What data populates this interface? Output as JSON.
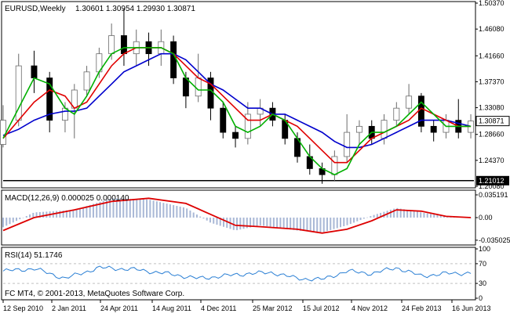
{
  "header": {
    "symbol": "EURUSD,Weekly",
    "ohlc": "1.30601 1.30954 1.29930 1.30871"
  },
  "watermark": "FC MT4, © 2001-2013, MetaQuotes Software Corp.",
  "colors": {
    "bull": "#6b6b6b",
    "bear": "#000000",
    "ma_fast": "#00b000",
    "ma_mid": "#e00000",
    "ma_slow": "#0000cc",
    "macd_hist": "#a9b8d6",
    "macd_signal": "#dd0000",
    "rsi": "#2a7fd4",
    "grid": "#c0c0c0",
    "level_line": "#000000"
  },
  "price_axis": {
    "ticks": [
      "1.50370",
      "1.46080",
      "1.41660",
      "1.37370",
      "1.33080",
      "1.28660",
      "1.24370",
      "1.20080"
    ],
    "current_price": "1.30871",
    "level_price": "1.21012"
  },
  "x_axis": {
    "labels": [
      "12 Sep 2010",
      "2 Jan 2011",
      "24 Apr 2011",
      "14 Aug 2011",
      "4 Dec 2011",
      "25 Mar 2012",
      "15 Jul 2012",
      "4 Nov 2012",
      "24 Feb 2013",
      "16 Jun 2013"
    ]
  },
  "macd": {
    "label": "MACD(12,26,9) 0.000025 0.000140",
    "ticks": [
      "0.035191",
      "0.00",
      "-0.035025"
    ]
  },
  "rsi": {
    "label": "RSI(14) 51.1746",
    "ticks": [
      "100",
      "70",
      "30",
      "0"
    ]
  },
  "chart_data": [
    {
      "type": "candlestick",
      "title": "EURUSD,Weekly",
      "ylim": [
        1.2008,
        1.5037
      ],
      "level_line": 1.21012,
      "x_range": [
        "2010-08-01",
        "2013-06-30"
      ],
      "candles": [
        {
          "d": "2010-08-01",
          "o": 1.27,
          "h": 1.335,
          "l": 1.265,
          "c": 1.31
        },
        {
          "d": "2010-09-05",
          "o": 1.31,
          "h": 1.42,
          "l": 1.3,
          "c": 1.4
        },
        {
          "d": "2010-10-10",
          "o": 1.4,
          "h": 1.425,
          "l": 1.355,
          "c": 1.38
        },
        {
          "d": "2010-11-14",
          "o": 1.38,
          "h": 1.39,
          "l": 1.29,
          "c": 1.31
        },
        {
          "d": "2010-12-19",
          "o": 1.31,
          "h": 1.34,
          "l": 1.29,
          "c": 1.33
        },
        {
          "d": "2011-01-09",
          "o": 1.33,
          "h": 1.37,
          "l": 1.28,
          "c": 1.36
        },
        {
          "d": "2011-02-06",
          "o": 1.36,
          "h": 1.4,
          "l": 1.35,
          "c": 1.39
        },
        {
          "d": "2011-03-06",
          "o": 1.39,
          "h": 1.43,
          "l": 1.38,
          "c": 1.42
        },
        {
          "d": "2011-04-03",
          "o": 1.42,
          "h": 1.47,
          "l": 1.41,
          "c": 1.45
        },
        {
          "d": "2011-05-01",
          "o": 1.45,
          "h": 1.495,
          "l": 1.4,
          "c": 1.42
        },
        {
          "d": "2011-05-29",
          "o": 1.42,
          "h": 1.46,
          "l": 1.4,
          "c": 1.44
        },
        {
          "d": "2011-06-26",
          "o": 1.44,
          "h": 1.455,
          "l": 1.4,
          "c": 1.42
        },
        {
          "d": "2011-07-24",
          "o": 1.42,
          "h": 1.46,
          "l": 1.4,
          "c": 1.44
        },
        {
          "d": "2011-08-21",
          "o": 1.44,
          "h": 1.45,
          "l": 1.37,
          "c": 1.38
        },
        {
          "d": "2011-09-18",
          "o": 1.38,
          "h": 1.39,
          "l": 1.33,
          "c": 1.35
        },
        {
          "d": "2011-10-16",
          "o": 1.35,
          "h": 1.42,
          "l": 1.34,
          "c": 1.38
        },
        {
          "d": "2011-11-13",
          "o": 1.38,
          "h": 1.39,
          "l": 1.31,
          "c": 1.33
        },
        {
          "d": "2011-12-11",
          "o": 1.33,
          "h": 1.34,
          "l": 1.28,
          "c": 1.29
        },
        {
          "d": "2012-01-08",
          "o": 1.29,
          "h": 1.3,
          "l": 1.265,
          "c": 1.28
        },
        {
          "d": "2012-02-05",
          "o": 1.28,
          "h": 1.34,
          "l": 1.27,
          "c": 1.32
        },
        {
          "d": "2012-03-04",
          "o": 1.32,
          "h": 1.345,
          "l": 1.3,
          "c": 1.33
        },
        {
          "d": "2012-04-01",
          "o": 1.33,
          "h": 1.34,
          "l": 1.3,
          "c": 1.31
        },
        {
          "d": "2012-04-29",
          "o": 1.31,
          "h": 1.32,
          "l": 1.27,
          "c": 1.28
        },
        {
          "d": "2012-05-27",
          "o": 1.28,
          "h": 1.29,
          "l": 1.24,
          "c": 1.25
        },
        {
          "d": "2012-06-24",
          "o": 1.25,
          "h": 1.27,
          "l": 1.22,
          "c": 1.23
        },
        {
          "d": "2012-07-22",
          "o": 1.23,
          "h": 1.24,
          "l": 1.205,
          "c": 1.22
        },
        {
          "d": "2012-08-19",
          "o": 1.22,
          "h": 1.26,
          "l": 1.21,
          "c": 1.25
        },
        {
          "d": "2012-09-16",
          "o": 1.25,
          "h": 1.32,
          "l": 1.24,
          "c": 1.29
        },
        {
          "d": "2012-10-14",
          "o": 1.29,
          "h": 1.31,
          "l": 1.27,
          "c": 1.3
        },
        {
          "d": "2012-11-11",
          "o": 1.3,
          "h": 1.31,
          "l": 1.27,
          "c": 1.28
        },
        {
          "d": "2012-12-09",
          "o": 1.28,
          "h": 1.32,
          "l": 1.27,
          "c": 1.31
        },
        {
          "d": "2013-01-06",
          "o": 1.31,
          "h": 1.34,
          "l": 1.3,
          "c": 1.33
        },
        {
          "d": "2013-02-03",
          "o": 1.33,
          "h": 1.37,
          "l": 1.32,
          "c": 1.35
        },
        {
          "d": "2013-03-03",
          "o": 1.35,
          "h": 1.355,
          "l": 1.29,
          "c": 1.3
        },
        {
          "d": "2013-03-31",
          "o": 1.3,
          "h": 1.31,
          "l": 1.275,
          "c": 1.29
        },
        {
          "d": "2013-04-28",
          "o": 1.29,
          "h": 1.32,
          "l": 1.28,
          "c": 1.31
        },
        {
          "d": "2013-05-26",
          "o": 1.31,
          "h": 1.345,
          "l": 1.28,
          "c": 1.29
        },
        {
          "d": "2013-06-23",
          "o": 1.29,
          "h": 1.32,
          "l": 1.28,
          "c": 1.30871
        }
      ],
      "ma_fast": [
        1.28,
        1.33,
        1.38,
        1.37,
        1.33,
        1.32,
        1.35,
        1.39,
        1.42,
        1.43,
        1.43,
        1.43,
        1.43,
        1.42,
        1.38,
        1.36,
        1.36,
        1.34,
        1.3,
        1.29,
        1.3,
        1.32,
        1.31,
        1.28,
        1.25,
        1.23,
        1.22,
        1.23,
        1.27,
        1.29,
        1.29,
        1.3,
        1.32,
        1.34,
        1.32,
        1.3,
        1.3,
        1.3
      ],
      "ma_mid": [
        1.28,
        1.31,
        1.34,
        1.36,
        1.35,
        1.33,
        1.34,
        1.37,
        1.4,
        1.42,
        1.43,
        1.43,
        1.43,
        1.42,
        1.4,
        1.38,
        1.37,
        1.35,
        1.33,
        1.31,
        1.31,
        1.32,
        1.31,
        1.3,
        1.28,
        1.26,
        1.24,
        1.24,
        1.26,
        1.28,
        1.29,
        1.3,
        1.31,
        1.33,
        1.32,
        1.31,
        1.3,
        1.3
      ],
      "ma_slow": [
        1.285,
        1.295,
        1.31,
        1.32,
        1.325,
        1.325,
        1.33,
        1.35,
        1.37,
        1.39,
        1.4,
        1.41,
        1.42,
        1.42,
        1.41,
        1.39,
        1.37,
        1.36,
        1.345,
        1.33,
        1.33,
        1.32,
        1.32,
        1.31,
        1.3,
        1.29,
        1.275,
        1.265,
        1.265,
        1.27,
        1.28,
        1.29,
        1.3,
        1.31,
        1.31,
        1.31,
        1.305,
        1.3
      ]
    },
    {
      "type": "bar",
      "title": "MACD(12,26,9) 0.000025 0.000140",
      "ylim": [
        -0.04,
        0.04
      ],
      "x_range": [
        "2010-08-01",
        "2013-06-30"
      ],
      "x": [
        "2010-08-01",
        "2010-10-10",
        "2011-01-09",
        "2011-04-03",
        "2011-06-26",
        "2011-09-18",
        "2011-11-13",
        "2012-01-08",
        "2012-03-04",
        "2012-05-27",
        "2012-07-22",
        "2012-09-16",
        "2012-11-11",
        "2013-01-06",
        "2013-03-03",
        "2013-04-28",
        "2013-06-23"
      ],
      "histogram": [
        -0.015,
        0.008,
        0.012,
        0.03,
        0.028,
        0.015,
        -0.008,
        -0.02,
        -0.012,
        -0.02,
        -0.023,
        -0.012,
        0.003,
        0.015,
        0.008,
        0.002,
        0.0
      ],
      "signal": [
        -0.02,
        0.0,
        0.012,
        0.025,
        0.03,
        0.022,
        0.005,
        -0.012,
        -0.014,
        -0.018,
        -0.024,
        -0.018,
        -0.005,
        0.012,
        0.01,
        0.002,
        0.0
      ]
    },
    {
      "type": "line",
      "title": "RSI(14) 51.1746",
      "ylim": [
        0,
        100
      ],
      "levels": [
        30,
        70
      ],
      "x_range": [
        "2010-08-01",
        "2013-06-30"
      ],
      "x": [
        "2010-08-01",
        "2010-10-10",
        "2010-12-19",
        "2011-03-06",
        "2011-05-29",
        "2011-08-21",
        "2011-10-16",
        "2011-12-11",
        "2012-02-05",
        "2012-04-01",
        "2012-05-27",
        "2012-07-22",
        "2012-09-16",
        "2012-11-11",
        "2013-01-06",
        "2013-03-03",
        "2013-04-28",
        "2013-06-23"
      ],
      "values": [
        55,
        60,
        40,
        62,
        58,
        48,
        40,
        45,
        50,
        52,
        40,
        38,
        55,
        50,
        62,
        45,
        50,
        51.1746
      ]
    }
  ]
}
